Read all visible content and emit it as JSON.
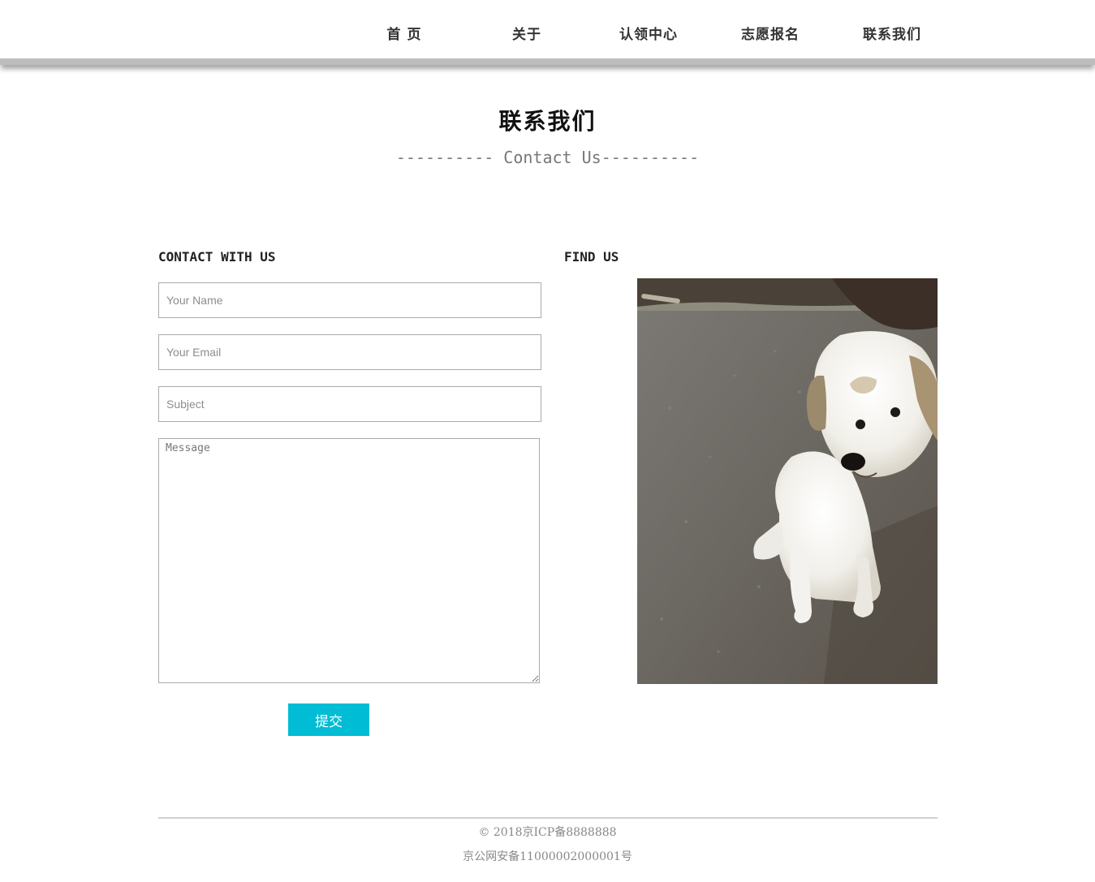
{
  "nav": {
    "items": [
      {
        "label": "首 页"
      },
      {
        "label": "关于"
      },
      {
        "label": "认领中心"
      },
      {
        "label": "志愿报名"
      },
      {
        "label": "联系我们"
      }
    ]
  },
  "header": {
    "title": "联系我们",
    "subtitle": "---------- Contact Us----------"
  },
  "contact": {
    "heading": "CONTACT WITH US",
    "name_placeholder": "Your Name",
    "email_placeholder": "Your Email",
    "subject_placeholder": "Subject",
    "message_placeholder": "Message",
    "submit_label": "提交"
  },
  "find": {
    "heading": "FIND US",
    "image_alt": "white puppy sitting on dirt ground"
  },
  "footer": {
    "copyright": "© 2018京ICP备8888888",
    "record": "京公网安备11000002000001号"
  }
}
